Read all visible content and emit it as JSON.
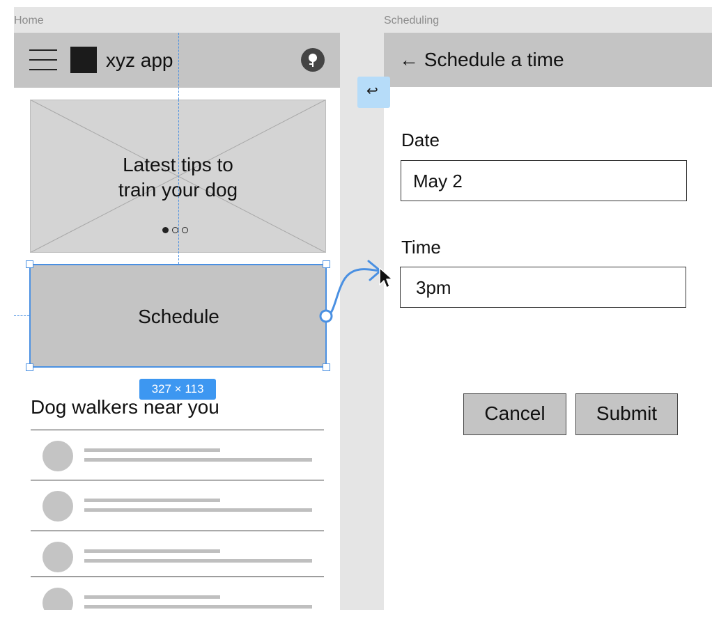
{
  "frames": {
    "home": {
      "label": "Home",
      "app_title": "xyz app",
      "icons": {
        "menu": "hamburger-menu-icon",
        "logo": "app-logo",
        "avatar": "user-avatar-icon"
      },
      "hero": {
        "title_line1": "Latest tips to",
        "title_line2": "train your dog",
        "carousel_page": 1,
        "carousel_total": 3
      },
      "schedule_button_label": "Schedule",
      "section_title": "Dog walkers near you",
      "list_items": [
        {},
        {},
        {},
        {}
      ]
    },
    "scheduling": {
      "label": "Scheduling",
      "back_arrow": "←",
      "title": "Schedule a time",
      "date_label": "Date",
      "date_value": "May 2",
      "time_label": "Time",
      "time_value": "3pm",
      "cancel_label": "Cancel",
      "submit_label": "Submit"
    }
  },
  "prototype": {
    "back_icon": "↩",
    "selection_size": "327 × 113",
    "connection": {
      "from": "Schedule",
      "to": "Scheduling"
    }
  },
  "colors": {
    "canvas": "#e5e5e5",
    "placeholder_gray": "#c4c4c4",
    "selection_blue": "#4a90e2",
    "badge_blue": "#3d97f1",
    "back_badge_bg": "#b6dcf9"
  }
}
